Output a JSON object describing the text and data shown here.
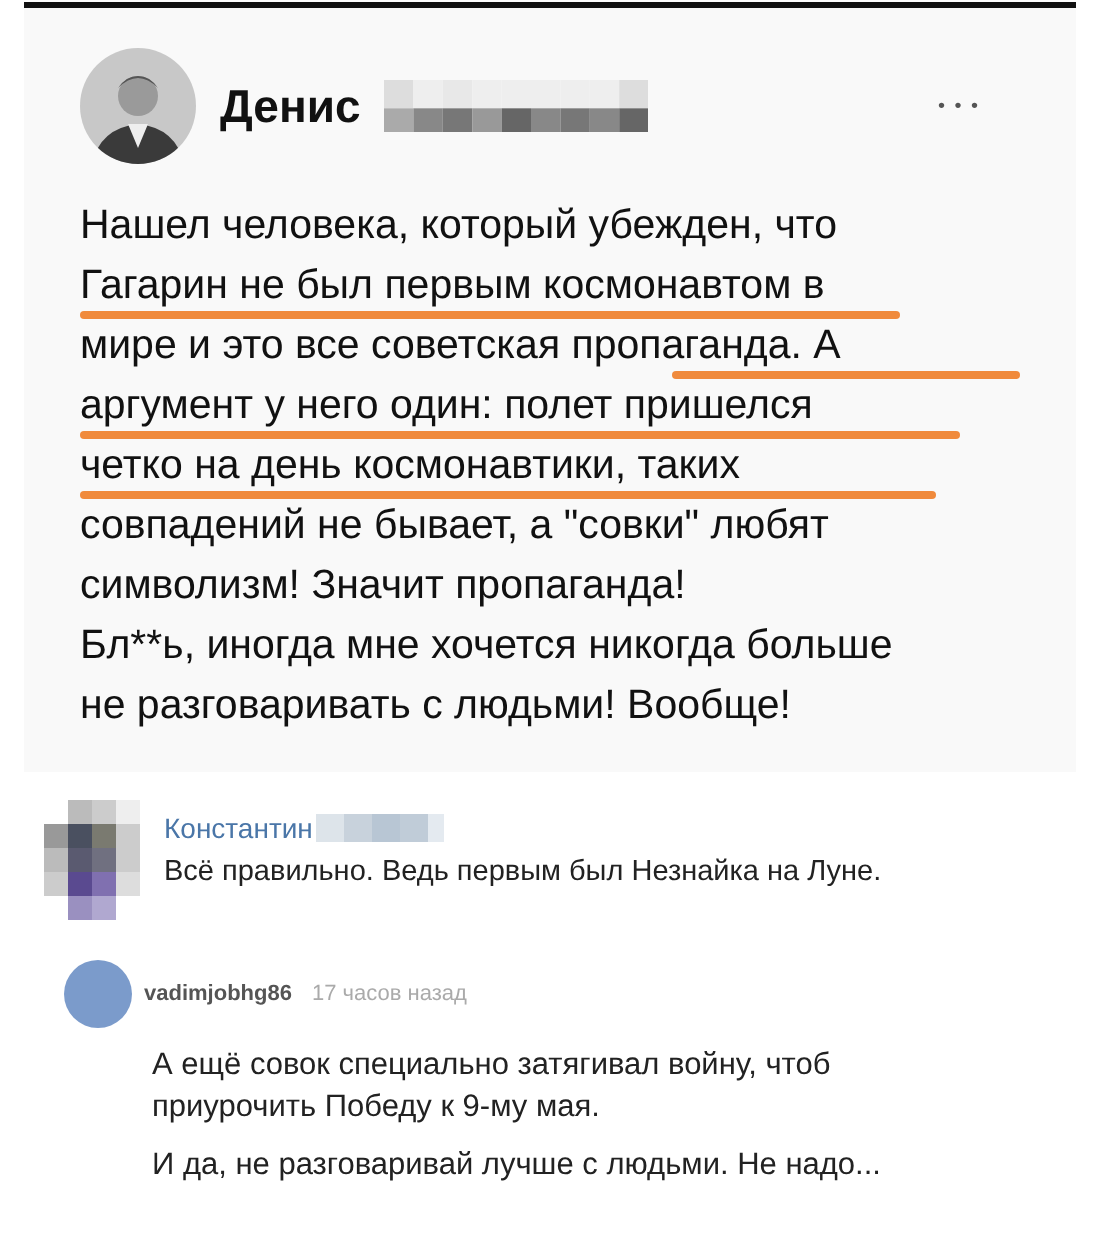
{
  "post": {
    "author": "Денис",
    "more": "• • •",
    "text_lines": [
      "Нашел человека, который убежден, что",
      "Гагарин не был первым космонавтом в",
      "мире и это все советская пропаганда. А",
      "аргумент у него один: полет пришелся",
      "четко на день космонавтики, таких",
      "совпадений не бывает, а \"совки\" любят",
      "символизм! Значит пропаганда!",
      "Бл**ь, иногда мне хочется никогда больше",
      "не разговаривать с людьми! Вообще!"
    ]
  },
  "comments": [
    {
      "kind": "vk",
      "author": "Константин",
      "text": "Всё правильно. Ведь первым был Незнайка на Луне."
    },
    {
      "kind": "forum",
      "author": "vadimjobhg86",
      "time": "17 часов назад",
      "paragraphs": [
        "А ещё совок специально затягивал войну, чтоб приурочить Победу к 9-му мая.",
        "И да, не разговаривай лучше с людьми. Не надо..."
      ]
    }
  ]
}
